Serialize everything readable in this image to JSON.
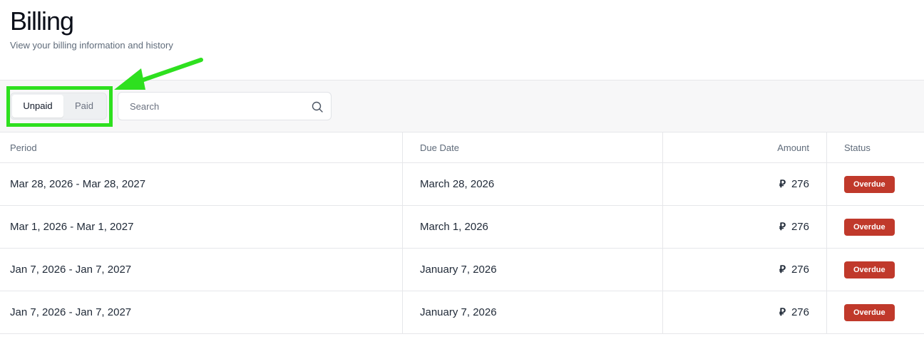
{
  "header": {
    "title": "Billing",
    "subtitle": "View your billing information and history"
  },
  "tabs": {
    "unpaid_label": "Unpaid",
    "paid_label": "Paid",
    "selected": "Unpaid"
  },
  "search": {
    "placeholder": "Search",
    "value": ""
  },
  "annotation": {
    "highlight_color": "#2ee01f",
    "arrow_color": "#2ee01f"
  },
  "table": {
    "columns": {
      "period": "Period",
      "due_date": "Due Date",
      "amount": "Amount",
      "status": "Status"
    },
    "rows": [
      {
        "period": "Mar 28, 2026 - Mar 28, 2027",
        "due_date": "March 28, 2026",
        "currency_symbol": "⃁",
        "amount": "276",
        "status": "Overdue"
      },
      {
        "period": "Mar 1, 2026 - Mar 1, 2027",
        "due_date": "March 1, 2026",
        "currency_symbol": "⃁",
        "amount": "276",
        "status": "Overdue"
      },
      {
        "period": "Jan 7, 2026 - Jan 7, 2027",
        "due_date": "January 7, 2026",
        "currency_symbol": "⃁",
        "amount": "276",
        "status": "Overdue"
      },
      {
        "period": "Jan 7, 2026 - Jan 7, 2027",
        "due_date": "January 7, 2026",
        "currency_symbol": "⃁",
        "amount": "276",
        "status": "Overdue"
      }
    ]
  },
  "colors": {
    "overdue_badge": "#c0392b",
    "page_background": "#ffffff",
    "toolbar_background": "#f7f7f8"
  }
}
